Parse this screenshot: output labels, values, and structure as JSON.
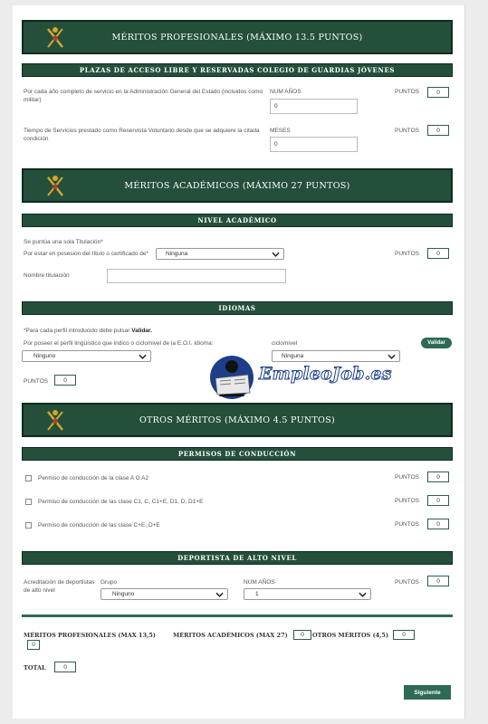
{
  "sections": {
    "profesionales": {
      "title": "MÉRITOS PROFESIONALES (MÁXIMO 13.5 PUNTOS)",
      "subtitle": "PLAZAS DE ACCESO LIBRE Y RESERVADAS COLEGIO DE GUARDIAS JÓVENES",
      "row1": {
        "label": "Por cada año completo de servicio en la Administración General del Estado (incluidos como militar)",
        "field_label": "NUM AÑOS",
        "value": "0",
        "points_label": "PUNTOS",
        "points": "0"
      },
      "row2": {
        "label": "Tiempo de Servicios prestado como Reservista Voluntario desde que se adquiere la citada condición",
        "field_label": "MESES",
        "value": "0",
        "points_label": "PUNTOS",
        "points": "0"
      }
    },
    "academicos": {
      "title": "MÉRITOS ACADÉMICOS (MÁXIMO 27 PUNTOS)",
      "nivel_title": "NIVEL ACADÉMICO",
      "note": "Se puntúa una sola Titulación*",
      "titulo_label": "Por estar en posesión del título o certificado de*",
      "titulo_value": "Ninguna",
      "points_label": "PUNTOS",
      "points": "0",
      "nombre_label": "Nombre titulación",
      "nombre_value": "",
      "idiomas_title": "IDIOMAS",
      "idiomas_note_prefix": "*Para cada perfil introducido debe pulsar ",
      "idiomas_note_bold": "Validar.",
      "perfil_label": "Por poseer el perfil lingüístico que indico o ciclo/nivel de la E.O.I. Idioma:",
      "idioma_value": "Ninguno",
      "ciclo_label": "ciclo/nivel",
      "ciclo_value": "Ninguna",
      "validar_label": "Validar",
      "idiomas_points_label": "PUNTOS",
      "idiomas_points": "0"
    },
    "otros": {
      "title": "OTROS MÉRITOS (MÁXIMO 4.5 PUNTOS)",
      "permisos_title": "PERMISOS DE CONDUCCIÓN",
      "permisos": [
        {
          "label": "Permiso de conducción de la clase A O A2",
          "points_label": "PUNTOS",
          "points": "0"
        },
        {
          "label": "Permiso de conducción de las clase C1, C, C1+E, D1, D, D1+E",
          "points_label": "PUNTOS",
          "points": "0"
        },
        {
          "label": "Permiso de conducción de las clase C+E, D+E",
          "points_label": "PUNTOS",
          "points": "0"
        }
      ],
      "deportista_title": "DEPORTISTA DE ALTO NIVEL",
      "acreditacion_label": "Acreditación de deportistas de alto nivel",
      "grupo_label": "Grupo",
      "grupo_value": "Ninguno",
      "num_label": "NUM AÑOS",
      "num_value": "1",
      "points_label": "PUNTOS",
      "points": "0"
    }
  },
  "summary": {
    "prof_label": "MÉRITOS PROFESIONALES (MAX 13,5)",
    "prof_value": "0",
    "acad_label": "MÉRITOS ACADÉMICOS (MAX 27)",
    "acad_value": "0",
    "otros_label": "OTROS MÉRITOS (4,5)",
    "otros_value": "0",
    "total_label": "TOTAL",
    "total_value": "0",
    "next_button": "Siguiente"
  },
  "watermark": {
    "text": "EmpleoJob.es"
  },
  "colors": {
    "banner": "#244f3b",
    "accent": "#2e6a55",
    "emblem": "#d4a82a"
  }
}
